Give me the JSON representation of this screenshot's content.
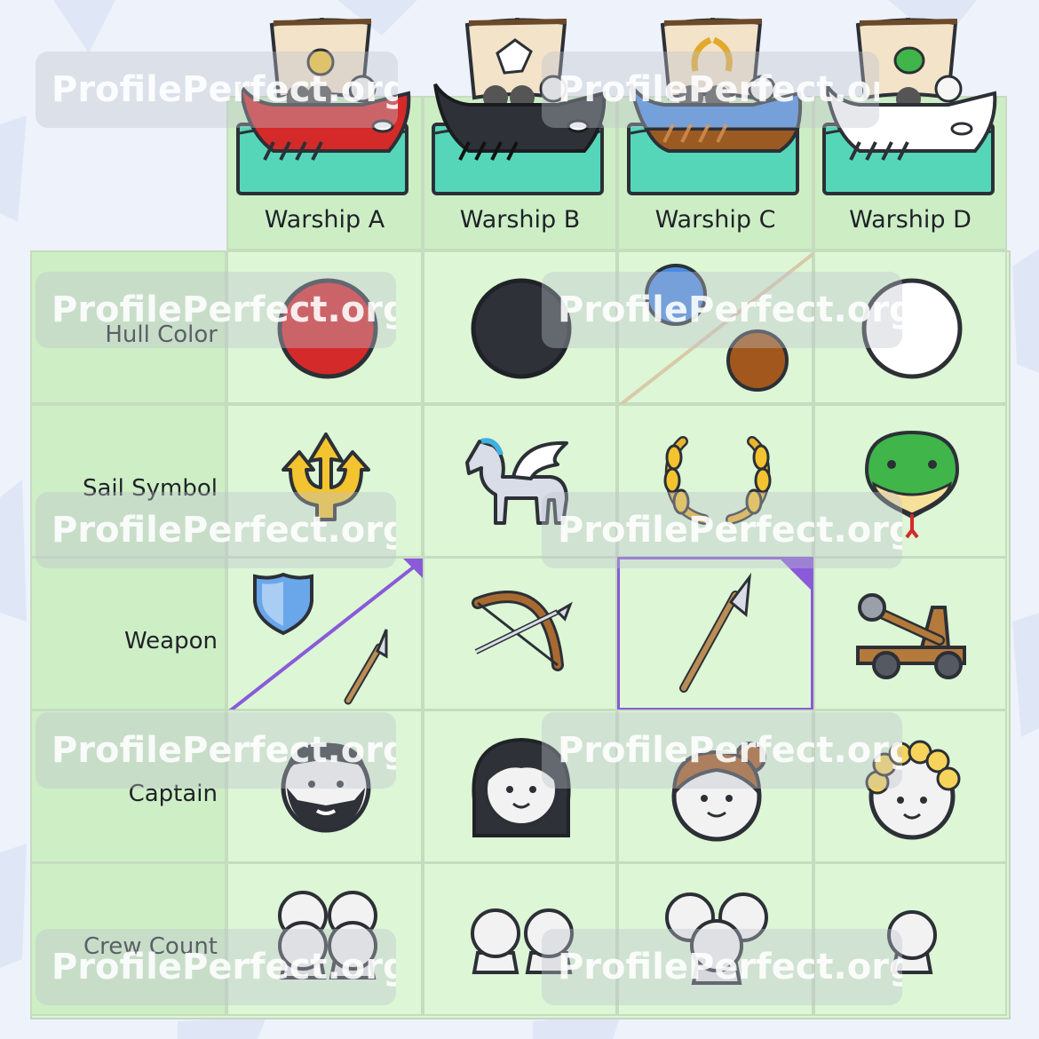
{
  "columns": [
    {
      "label": "Warship A",
      "hull": "#d42a2a",
      "sail_icon": "trident-icon",
      "captain": "bearded-man"
    },
    {
      "label": "Warship B",
      "hull": "#2e3238",
      "sail_icon": "pegasus-icon",
      "captain": "long-dark-hair"
    },
    {
      "label": "Warship C",
      "hull": "#4a8be0",
      "sail_icon": "laurel-wreath-icon",
      "captain": "bun-hair"
    },
    {
      "label": "Warship D",
      "hull": "#ffffff",
      "sail_icon": "snake-icon",
      "captain": "curly-blond-hair"
    }
  ],
  "rows": [
    {
      "label": "Hull Color"
    },
    {
      "label": "Sail Symbol"
    },
    {
      "label": "Weapon"
    },
    {
      "label": "Captain"
    },
    {
      "label": "Crew Count"
    }
  ],
  "hull_colors": [
    "red",
    "black",
    "blue / brown",
    "white"
  ],
  "weapons": [
    "shield / spear",
    "bow",
    "spear",
    "catapult"
  ],
  "crew_counts": [
    4,
    2,
    3,
    1
  ],
  "watermark": "ProfilePerfect.org",
  "colors": {
    "accent_purple": "#8a5ad8",
    "cell_green": "#dcf6d6",
    "sea": "#56d6b8"
  }
}
